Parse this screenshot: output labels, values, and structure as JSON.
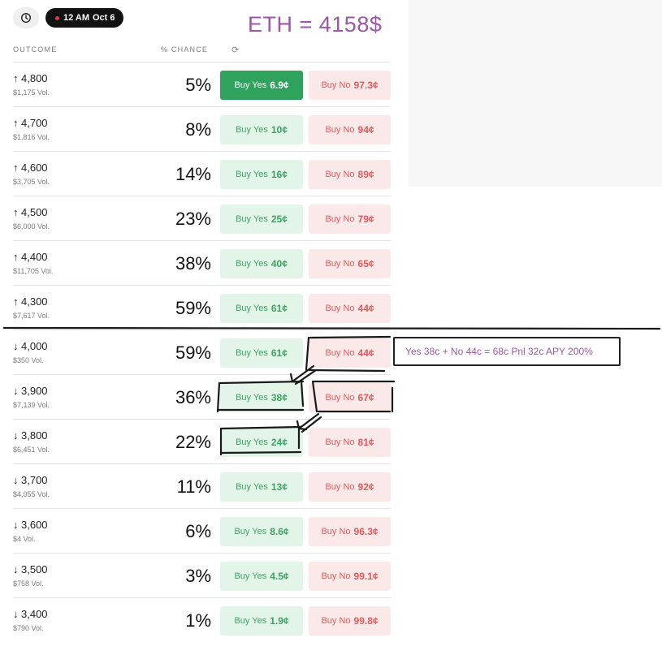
{
  "header": {
    "time_label": "12 AM",
    "date_label": "Oct 6",
    "asset_price": "ETH = 4158$"
  },
  "columns": {
    "outcome": "OUTCOME",
    "chance": "% CHANCE"
  },
  "icons": {
    "clock": "clock-icon",
    "refresh": "refresh-icon",
    "live_dot": "live-dot-icon"
  },
  "colors": {
    "yes_bg": "#e3f5e8",
    "yes_text": "#3ea263",
    "yes_active": "#2fa25d",
    "no_bg": "#fbe9e9",
    "no_text": "#e15a5a",
    "annotation": "#9b57a8"
  },
  "rows": [
    {
      "dir": "↑",
      "strike": "4,800",
      "vol": "$1,175 Vol.",
      "chance": "5%",
      "yes_label": "Buy Yes",
      "yes_price": "6.9¢",
      "no_label": "Buy No",
      "no_price": "97.3¢",
      "yes_active": true
    },
    {
      "dir": "↑",
      "strike": "4,700",
      "vol": "$1,816 Vol.",
      "chance": "8%",
      "yes_label": "Buy Yes",
      "yes_price": "10¢",
      "no_label": "Buy No",
      "no_price": "94¢"
    },
    {
      "dir": "↑",
      "strike": "4,600",
      "vol": "$3,705 Vol.",
      "chance": "14%",
      "yes_label": "Buy Yes",
      "yes_price": "16¢",
      "no_label": "Buy No",
      "no_price": "89¢"
    },
    {
      "dir": "↑",
      "strike": "4,500",
      "vol": "$6,000 Vol.",
      "chance": "23%",
      "yes_label": "Buy Yes",
      "yes_price": "25¢",
      "no_label": "Buy No",
      "no_price": "79¢"
    },
    {
      "dir": "↑",
      "strike": "4,400",
      "vol": "$11,705 Vol.",
      "chance": "38%",
      "yes_label": "Buy Yes",
      "yes_price": "40¢",
      "no_label": "Buy No",
      "no_price": "65¢"
    },
    {
      "dir": "↑",
      "strike": "4,300",
      "vol": "$7,617 Vol.",
      "chance": "59%",
      "yes_label": "Buy Yes",
      "yes_price": "61¢",
      "no_label": "Buy No",
      "no_price": "44¢"
    },
    {
      "dir": "↓",
      "strike": "4,000",
      "vol": "$350 Vol.",
      "chance": "59%",
      "yes_label": "Buy Yes",
      "yes_price": "61¢",
      "no_label": "Buy No",
      "no_price": "44¢"
    },
    {
      "dir": "↓",
      "strike": "3,900",
      "vol": "$7,139 Vol.",
      "chance": "36%",
      "yes_label": "Buy Yes",
      "yes_price": "38¢",
      "no_label": "Buy No",
      "no_price": "67¢"
    },
    {
      "dir": "↓",
      "strike": "3,800",
      "vol": "$6,451 Vol.",
      "chance": "22%",
      "yes_label": "Buy Yes",
      "yes_price": "24¢",
      "no_label": "Buy No",
      "no_price": "81¢"
    },
    {
      "dir": "↓",
      "strike": "3,700",
      "vol": "$4,055 Vol.",
      "chance": "11%",
      "yes_label": "Buy Yes",
      "yes_price": "13¢",
      "no_label": "Buy No",
      "no_price": "92¢"
    },
    {
      "dir": "↓",
      "strike": "3,600",
      "vol": "$4 Vol.",
      "chance": "6%",
      "yes_label": "Buy Yes",
      "yes_price": "8.6¢",
      "no_label": "Buy No",
      "no_price": "96.3¢"
    },
    {
      "dir": "↓",
      "strike": "3,500",
      "vol": "$758 Vol.",
      "chance": "3%",
      "yes_label": "Buy Yes",
      "yes_price": "4.5¢",
      "no_label": "Buy No",
      "no_price": "99.1¢"
    },
    {
      "dir": "↓",
      "strike": "3,400",
      "vol": "$790 Vol.",
      "chance": "1%",
      "yes_label": "Buy Yes",
      "yes_price": "1.9¢",
      "no_label": "Buy No",
      "no_price": "99.8¢"
    }
  ],
  "annotation": {
    "text": "Yes 38c + No 44c = 68c Pnl 32c APY 200%"
  }
}
